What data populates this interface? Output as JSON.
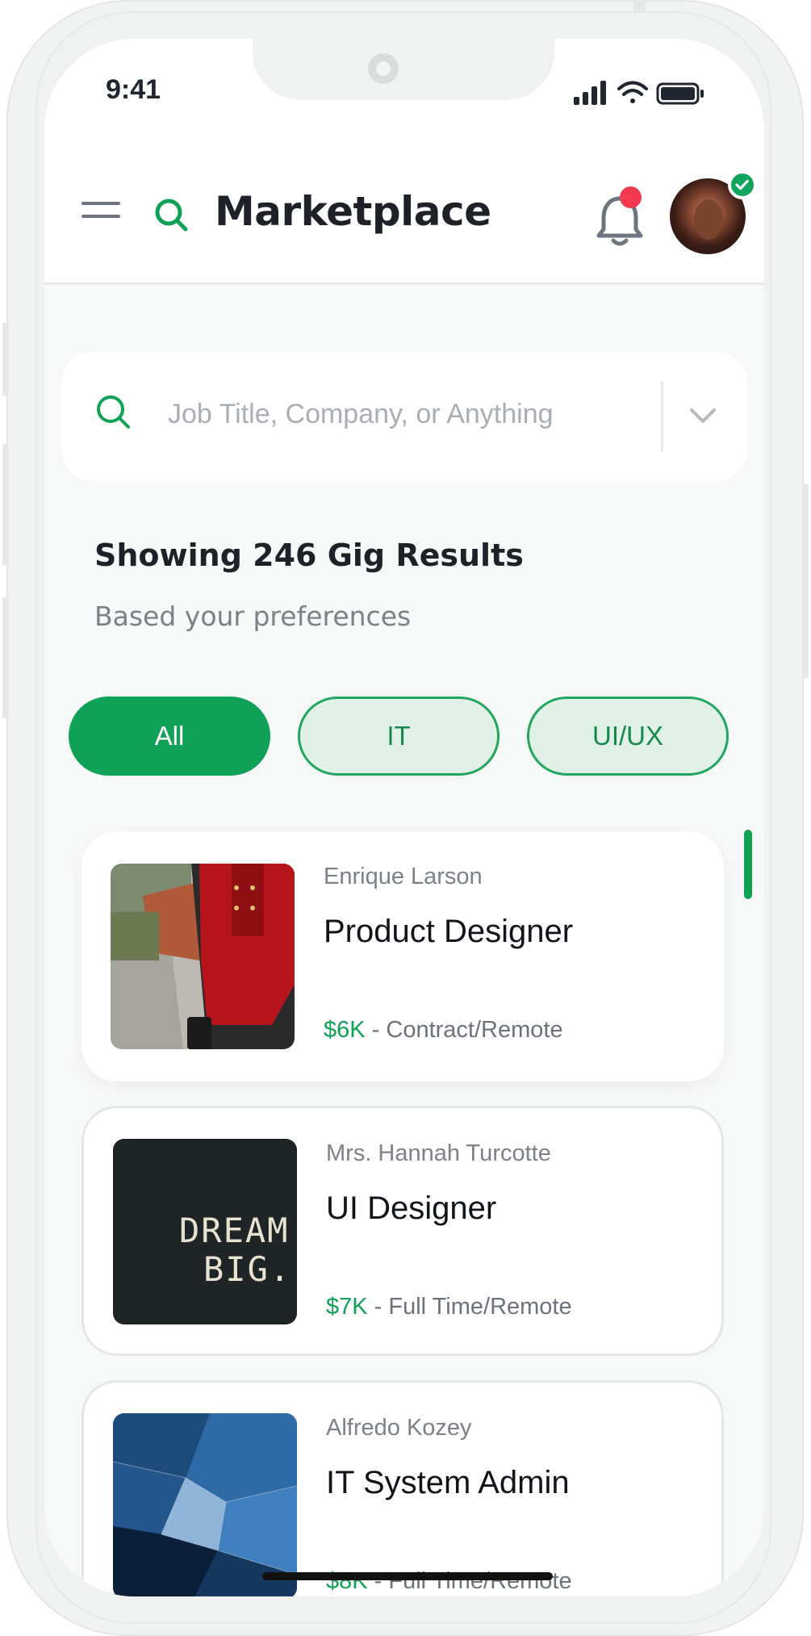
{
  "status_bar": {
    "time": "9:41"
  },
  "header": {
    "title": "Marketplace"
  },
  "search": {
    "placeholder": "Job Title, Company, or Anything"
  },
  "results": {
    "title": "Showing 246 Gig Results",
    "subtitle": "Based your preferences"
  },
  "filters": [
    {
      "label": "All",
      "active": true
    },
    {
      "label": "IT",
      "active": false
    },
    {
      "label": "UI/UX",
      "active": false
    }
  ],
  "jobs": [
    {
      "company": "Enrique Larson",
      "title": "Product Designer",
      "pay": "$6K",
      "terms": "Contract/Remote",
      "separator": " - ",
      "thumbnail": "woman-red-suit-photo"
    },
    {
      "company": "Mrs. Hannah Turcotte",
      "title": "UI Designer",
      "pay": "$7K",
      "terms": "Full Time/Remote",
      "separator": " - ",
      "thumbnail": "dream-big-chalkboard-photo",
      "thumb_text": "DREAM\nBIG."
    },
    {
      "company": "Alfredo Kozey",
      "title": "IT System Admin",
      "pay": "$8K",
      "terms": "Full Time/Remote",
      "separator": " - ",
      "thumbnail": "glass-building-photo"
    }
  ],
  "colors": {
    "accent": "#0fa256",
    "notification": "#f4394f",
    "chip_bg": "#e2f1e8"
  }
}
